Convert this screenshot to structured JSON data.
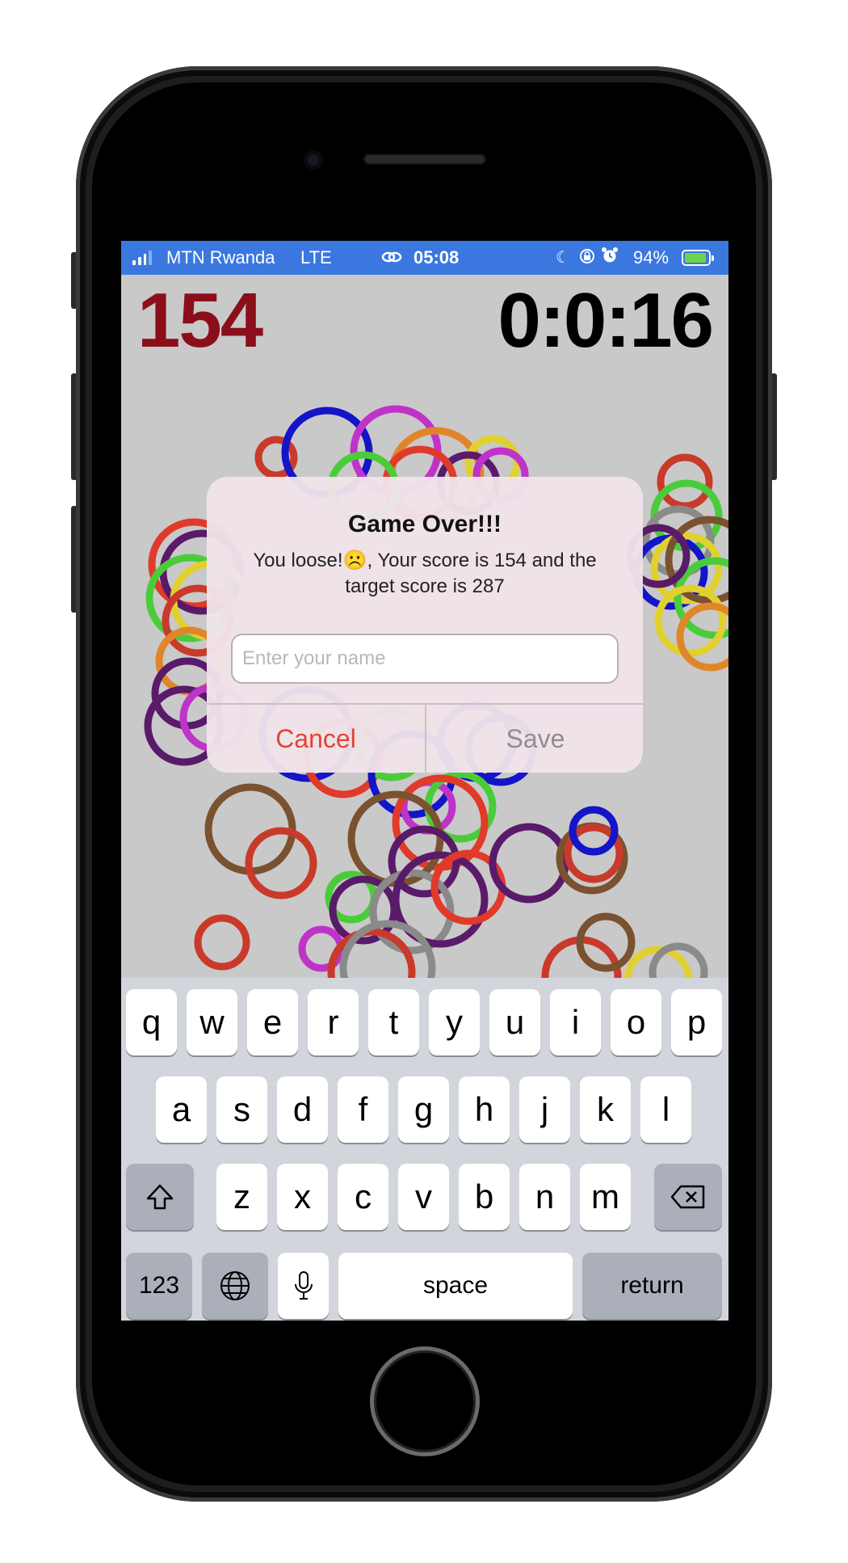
{
  "status_bar": {
    "carrier": "MTN Rwanda",
    "network": "LTE",
    "time": "05:08",
    "battery_percent": "94%",
    "battery_level": 0.94,
    "icons": [
      "signal-icon",
      "link-icon",
      "moon-icon",
      "orientation-lock-icon",
      "alarm-icon",
      "battery-charging-icon"
    ]
  },
  "game": {
    "score": "154",
    "timer": "0:0:16"
  },
  "dialog": {
    "title": "Game Over!!!",
    "message": "You loose!☹️, Your score is 154 and the target score is 287",
    "input_placeholder": "Enter your name",
    "input_value": "",
    "cancel_label": "Cancel",
    "save_label": "Save"
  },
  "keyboard": {
    "row1": [
      "q",
      "w",
      "e",
      "r",
      "t",
      "y",
      "u",
      "i",
      "o",
      "p"
    ],
    "row2": [
      "a",
      "s",
      "d",
      "f",
      "g",
      "h",
      "j",
      "k",
      "l"
    ],
    "row3": [
      "z",
      "x",
      "c",
      "v",
      "b",
      "n",
      "m"
    ],
    "numbers_label": "123",
    "space_label": "space",
    "return_label": "return",
    "icons": [
      "shift-icon",
      "delete-icon",
      "globe-icon",
      "microphone-icon"
    ]
  },
  "colors": {
    "status_bar": "#3a78e0",
    "score": "#8b0f1a",
    "cancel": "#e04535",
    "game_background": "#c9c9c9"
  }
}
